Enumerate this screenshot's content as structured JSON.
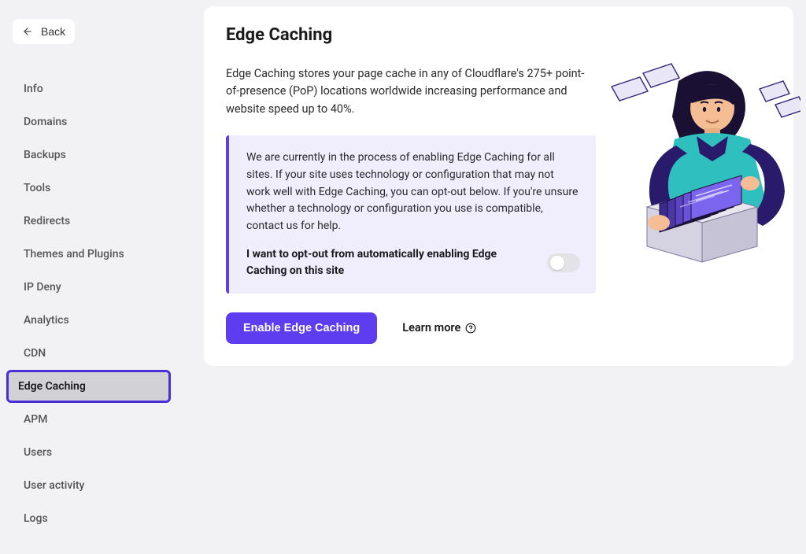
{
  "back_label": "Back",
  "sidebar": {
    "items": [
      {
        "label": "Info"
      },
      {
        "label": "Domains"
      },
      {
        "label": "Backups"
      },
      {
        "label": "Tools"
      },
      {
        "label": "Redirects"
      },
      {
        "label": "Themes and Plugins"
      },
      {
        "label": "IP Deny"
      },
      {
        "label": "Analytics"
      },
      {
        "label": "CDN"
      },
      {
        "label": "Edge Caching"
      },
      {
        "label": "APM"
      },
      {
        "label": "Users"
      },
      {
        "label": "User activity"
      },
      {
        "label": "Logs"
      }
    ],
    "active_index": 9
  },
  "page": {
    "title": "Edge Caching",
    "description": "Edge Caching stores your page cache in any of Cloudflare's 275+ point-of-presence (PoP) locations worldwide increasing performance and website speed up to 40%.",
    "notice": {
      "text": "We are currently in the process of enabling Edge Caching for all sites. If your site uses technology or configuration that may not work well with Edge Caching, you can opt-out below. If you're unsure whether a technology or configuration you use is compatible, contact us for help.",
      "optout_label": "I want to opt-out from automatically enabling Edge Caching on this site",
      "optout_value": false
    },
    "actions": {
      "enable_label": "Enable Edge Caching",
      "learn_more_label": "Learn more"
    }
  },
  "colors": {
    "accent": "#5e3cf0",
    "notice_bg": "#f0edfd",
    "page_bg": "#f2f2f5"
  }
}
